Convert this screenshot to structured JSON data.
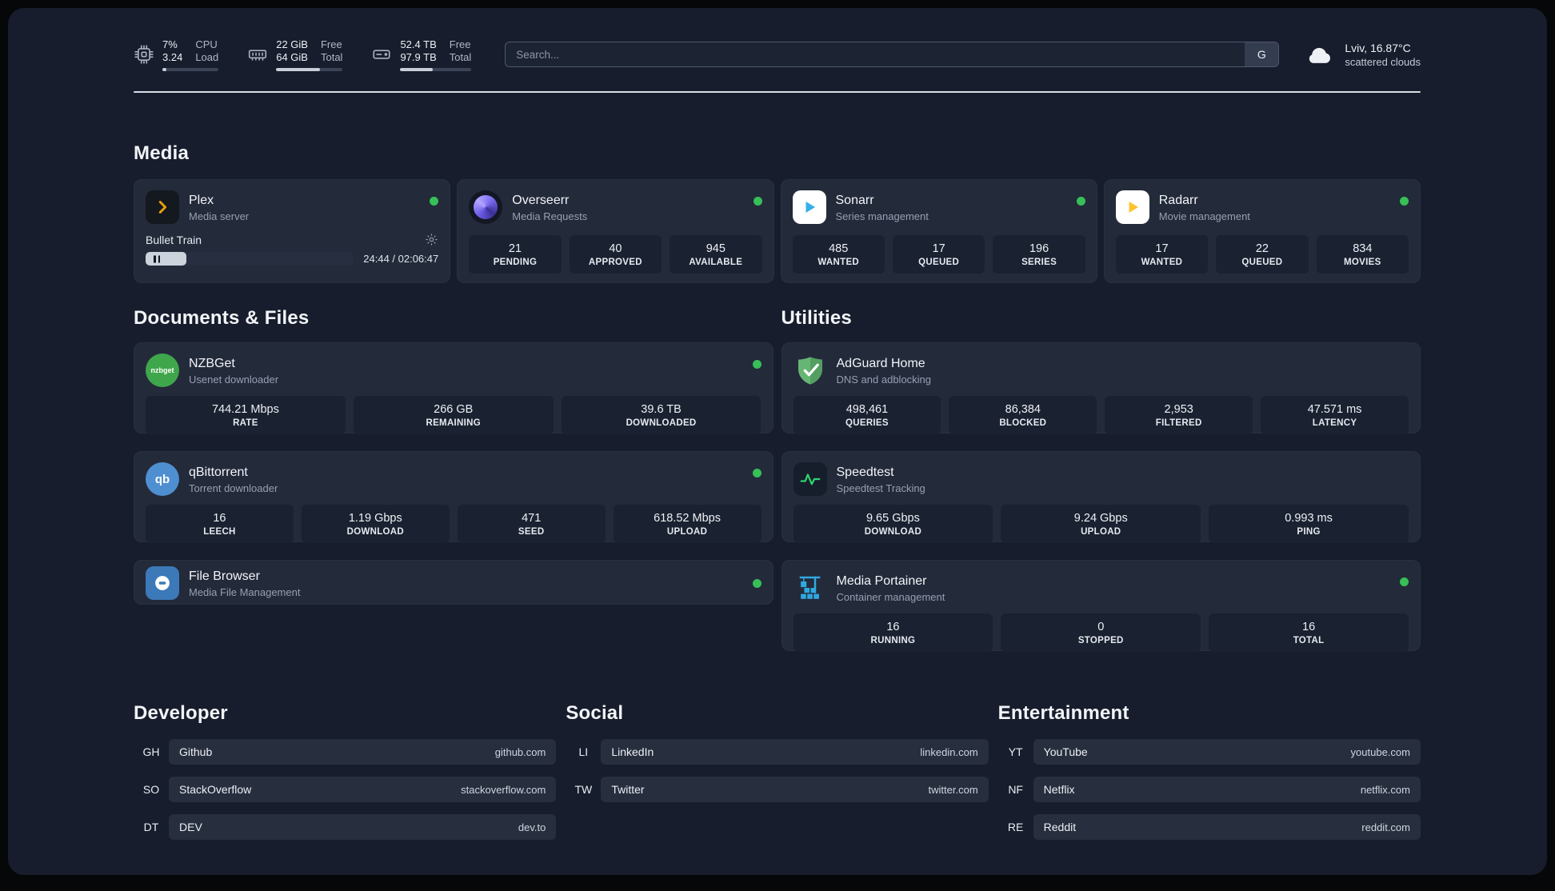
{
  "header": {
    "cpu": {
      "usage": "7%",
      "load": "3.24",
      "label_top": "CPU",
      "label_bottom": "Load",
      "progress": 7
    },
    "ram": {
      "free": "22 GiB",
      "total": "64 GiB",
      "label_top": "Free",
      "label_bottom": "Total",
      "progress": 66
    },
    "disk": {
      "free": "52.4 TB",
      "total": "97.9 TB",
      "label_top": "Free",
      "label_bottom": "Total",
      "progress": 46
    },
    "search": {
      "placeholder": "Search...",
      "button_label": "G"
    },
    "weather": {
      "location": "Lviv, 16.87°C",
      "condition": "scattered clouds"
    }
  },
  "sections": {
    "media": {
      "title": "Media",
      "plex": {
        "name": "Plex",
        "subtitle": "Media server",
        "icon": "plex-chevron",
        "now_playing": "Bullet Train",
        "time": "24:44 / 02:06:47",
        "progress": 19.5
      },
      "overseerr": {
        "name": "Overseerr",
        "subtitle": "Media Requests",
        "icon": "overseerr-swirl",
        "stats": [
          {
            "value": "21",
            "label": "PENDING"
          },
          {
            "value": "40",
            "label": "APPROVED"
          },
          {
            "value": "945",
            "label": "AVAILABLE"
          }
        ]
      },
      "sonarr": {
        "name": "Sonarr",
        "subtitle": "Series management",
        "icon": "sonarr-play",
        "stats": [
          {
            "value": "485",
            "label": "WANTED"
          },
          {
            "value": "17",
            "label": "QUEUED"
          },
          {
            "value": "196",
            "label": "SERIES"
          }
        ]
      },
      "radarr": {
        "name": "Radarr",
        "subtitle": "Movie management",
        "icon": "radarr-play",
        "stats": [
          {
            "value": "17",
            "label": "WANTED"
          },
          {
            "value": "22",
            "label": "QUEUED"
          },
          {
            "value": "834",
            "label": "MOVIES"
          }
        ]
      }
    },
    "documents": {
      "title": "Documents & Files",
      "nzbget": {
        "name": "NZBGet",
        "subtitle": "Usenet downloader",
        "icon_text": "nzbget",
        "stats": [
          {
            "value": "744.21 Mbps",
            "label": "RATE"
          },
          {
            "value": "266 GB",
            "label": "REMAINING"
          },
          {
            "value": "39.6 TB",
            "label": "DOWNLOADED"
          }
        ]
      },
      "qbittorrent": {
        "name": "qBittorrent",
        "subtitle": "Torrent downloader",
        "icon_text": "qb",
        "stats": [
          {
            "value": "16",
            "label": "LEECH"
          },
          {
            "value": "1.19 Gbps",
            "label": "DOWNLOAD"
          },
          {
            "value": "471",
            "label": "SEED"
          },
          {
            "value": "618.52 Mbps",
            "label": "UPLOAD"
          }
        ]
      },
      "filebrowser": {
        "name": "File Browser",
        "subtitle": "Media File Management",
        "icon": "filebrowser-disk"
      }
    },
    "utilities": {
      "title": "Utilities",
      "adguard": {
        "name": "AdGuard Home",
        "subtitle": "DNS and adblocking",
        "icon": "adguard-shield",
        "stats": [
          {
            "value": "498,461",
            "label": "QUERIES"
          },
          {
            "value": "86,384",
            "label": "BLOCKED"
          },
          {
            "value": "2,953",
            "label": "FILTERED"
          },
          {
            "value": "47.571 ms",
            "label": "LATENCY"
          }
        ]
      },
      "speedtest": {
        "name": "Speedtest",
        "subtitle": "Speedtest Tracking",
        "icon": "speedtest-pulse",
        "stats": [
          {
            "value": "9.65 Gbps",
            "label": "DOWNLOAD"
          },
          {
            "value": "9.24 Gbps",
            "label": "UPLOAD"
          },
          {
            "value": "0.993 ms",
            "label": "PING"
          }
        ]
      },
      "portainer": {
        "name": "Media Portainer",
        "subtitle": "Container management",
        "icon": "portainer-crane",
        "stats": [
          {
            "value": "16",
            "label": "RUNNING"
          },
          {
            "value": "0",
            "label": "STOPPED"
          },
          {
            "value": "16",
            "label": "TOTAL"
          }
        ]
      }
    },
    "bookmarks": {
      "developer": {
        "title": "Developer",
        "items": [
          {
            "abbr": "GH",
            "name": "Github",
            "url": "github.com"
          },
          {
            "abbr": "SO",
            "name": "StackOverflow",
            "url": "stackoverflow.com"
          },
          {
            "abbr": "DT",
            "name": "DEV",
            "url": "dev.to"
          }
        ]
      },
      "social": {
        "title": "Social",
        "items": [
          {
            "abbr": "LI",
            "name": "LinkedIn",
            "url": "linkedin.com"
          },
          {
            "abbr": "TW",
            "name": "Twitter",
            "url": "twitter.com"
          }
        ]
      },
      "entertainment": {
        "title": "Entertainment",
        "items": [
          {
            "abbr": "YT",
            "name": "YouTube",
            "url": "youtube.com"
          },
          {
            "abbr": "NF",
            "name": "Netflix",
            "url": "netflix.com"
          },
          {
            "abbr": "RE",
            "name": "Reddit",
            "url": "reddit.com"
          }
        ]
      }
    }
  },
  "colors": {
    "status_online": "#37c057",
    "plex_amber": "#e5a00d",
    "sonarr_blue": "#33b0e8",
    "radarr_yellow": "#ffc230",
    "nzbget_green": "#3fa64b",
    "qbittorrent_blue": "#4e8fd1",
    "adguard_green": "#66b574",
    "speedtest_green": "#2dd36f",
    "portainer_blue": "#2fa8e0",
    "panel_background": "#171d2c"
  }
}
